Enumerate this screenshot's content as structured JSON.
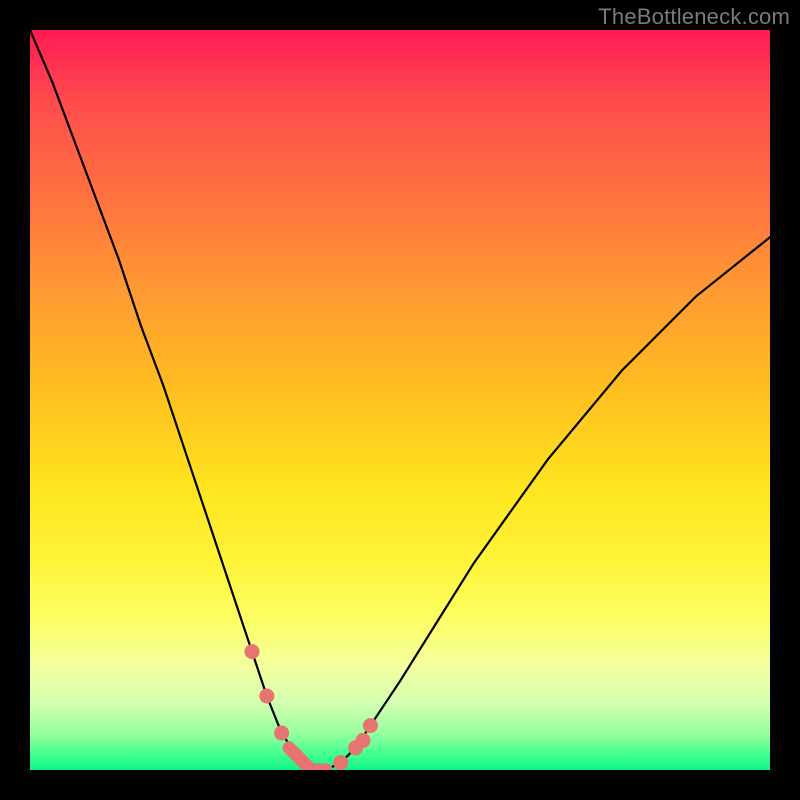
{
  "watermark": "TheBottleneck.com",
  "chart_data": {
    "type": "line",
    "title": "",
    "xlabel": "",
    "ylabel": "",
    "xlim": [
      0,
      100
    ],
    "ylim": [
      0,
      100
    ],
    "grid": false,
    "legend": false,
    "curve_note": "V-shaped bottleneck curve; y is % bottleneck, x is relative component strength; minimum ~0 near x≈35–40",
    "x": [
      0,
      3,
      6,
      9,
      12,
      15,
      18,
      21,
      24,
      27,
      30,
      32,
      34,
      36,
      38,
      40,
      42,
      44,
      46,
      50,
      55,
      60,
      65,
      70,
      75,
      80,
      85,
      90,
      95,
      100
    ],
    "y": [
      100,
      93,
      85,
      77,
      69,
      60,
      52,
      43,
      34,
      25,
      16,
      10,
      5,
      2,
      0,
      0,
      1,
      3,
      6,
      12,
      20,
      28,
      35,
      42,
      48,
      54,
      59,
      64,
      68,
      72
    ],
    "markers": {
      "note": "highlighted salmon segments near valley",
      "points_x": [
        30,
        32,
        34,
        35,
        36,
        37,
        38,
        39,
        40,
        42,
        44,
        45,
        46
      ],
      "points_y": [
        16,
        10,
        5,
        3,
        2,
        1,
        0,
        0,
        0,
        1,
        3,
        4,
        6
      ]
    },
    "colors": {
      "curve": "#000000",
      "markers": "#e77470",
      "gradient_top": "#ff1a53",
      "gradient_mid": "#ffe51f",
      "gradient_bottom": "#10f58a",
      "frame": "#000000",
      "watermark": "#7a7a7a"
    }
  }
}
